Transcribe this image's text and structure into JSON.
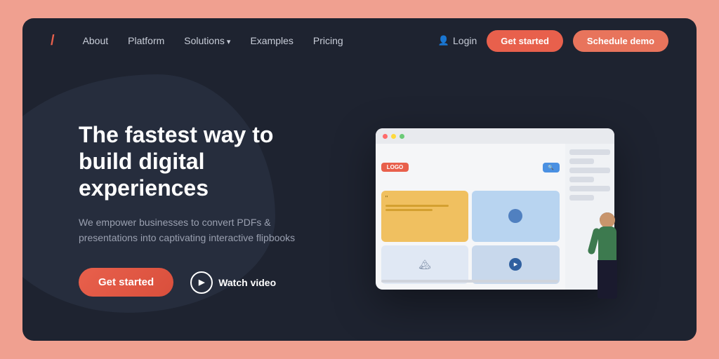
{
  "meta": {
    "bg_color": "#f0a090",
    "card_bg": "#1e2330"
  },
  "nav": {
    "logo": "/",
    "links": [
      {
        "label": "About",
        "has_arrow": false
      },
      {
        "label": "Platform",
        "has_arrow": false
      },
      {
        "label": "Solutions",
        "has_arrow": true
      },
      {
        "label": "Examples",
        "has_arrow": false
      },
      {
        "label": "Pricing",
        "has_arrow": false
      }
    ],
    "login_label": "Login",
    "get_started_label": "Get started",
    "schedule_demo_label": "Schedule demo"
  },
  "hero": {
    "title": "The fastest way to build digital experiences",
    "subtitle": "We empower businesses to convert PDFs & presentations into captivating interactive flipbooks",
    "get_started_label": "Get started",
    "watch_video_label": "Watch video"
  }
}
